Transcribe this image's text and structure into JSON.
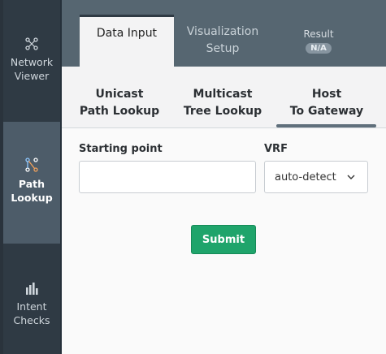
{
  "nav": {
    "items": [
      {
        "label_line1": "Network",
        "label_line2": "Viewer",
        "icon": "network-icon"
      },
      {
        "label_line1": "Path",
        "label_line2": "Lookup",
        "icon": "path-lookup-icon",
        "active": true
      },
      {
        "label_line1": "Intent",
        "label_line2": "Checks",
        "icon": "bar-chart-icon"
      }
    ]
  },
  "tabs": [
    {
      "label": "Data Input",
      "active": true
    },
    {
      "label_line1": "Visualization",
      "label_line2": "Setup"
    },
    {
      "label": "Result",
      "badge": "N/A"
    }
  ],
  "subtabs": [
    {
      "line1": "Unicast",
      "line2": "Path Lookup"
    },
    {
      "line1": "Multicast",
      "line2": "Tree Lookup"
    },
    {
      "line1": "Host",
      "line2": "To Gateway",
      "active": true
    }
  ],
  "form": {
    "starting_point_label": "Starting point",
    "starting_point_value": "",
    "vrf_label": "VRF",
    "vrf_value": "auto-detect",
    "submit_label": "Submit"
  },
  "colors": {
    "rail": "#2f3a44",
    "rail_active": "#4d5c69",
    "header": "#566671",
    "submit": "#1fa46b"
  }
}
